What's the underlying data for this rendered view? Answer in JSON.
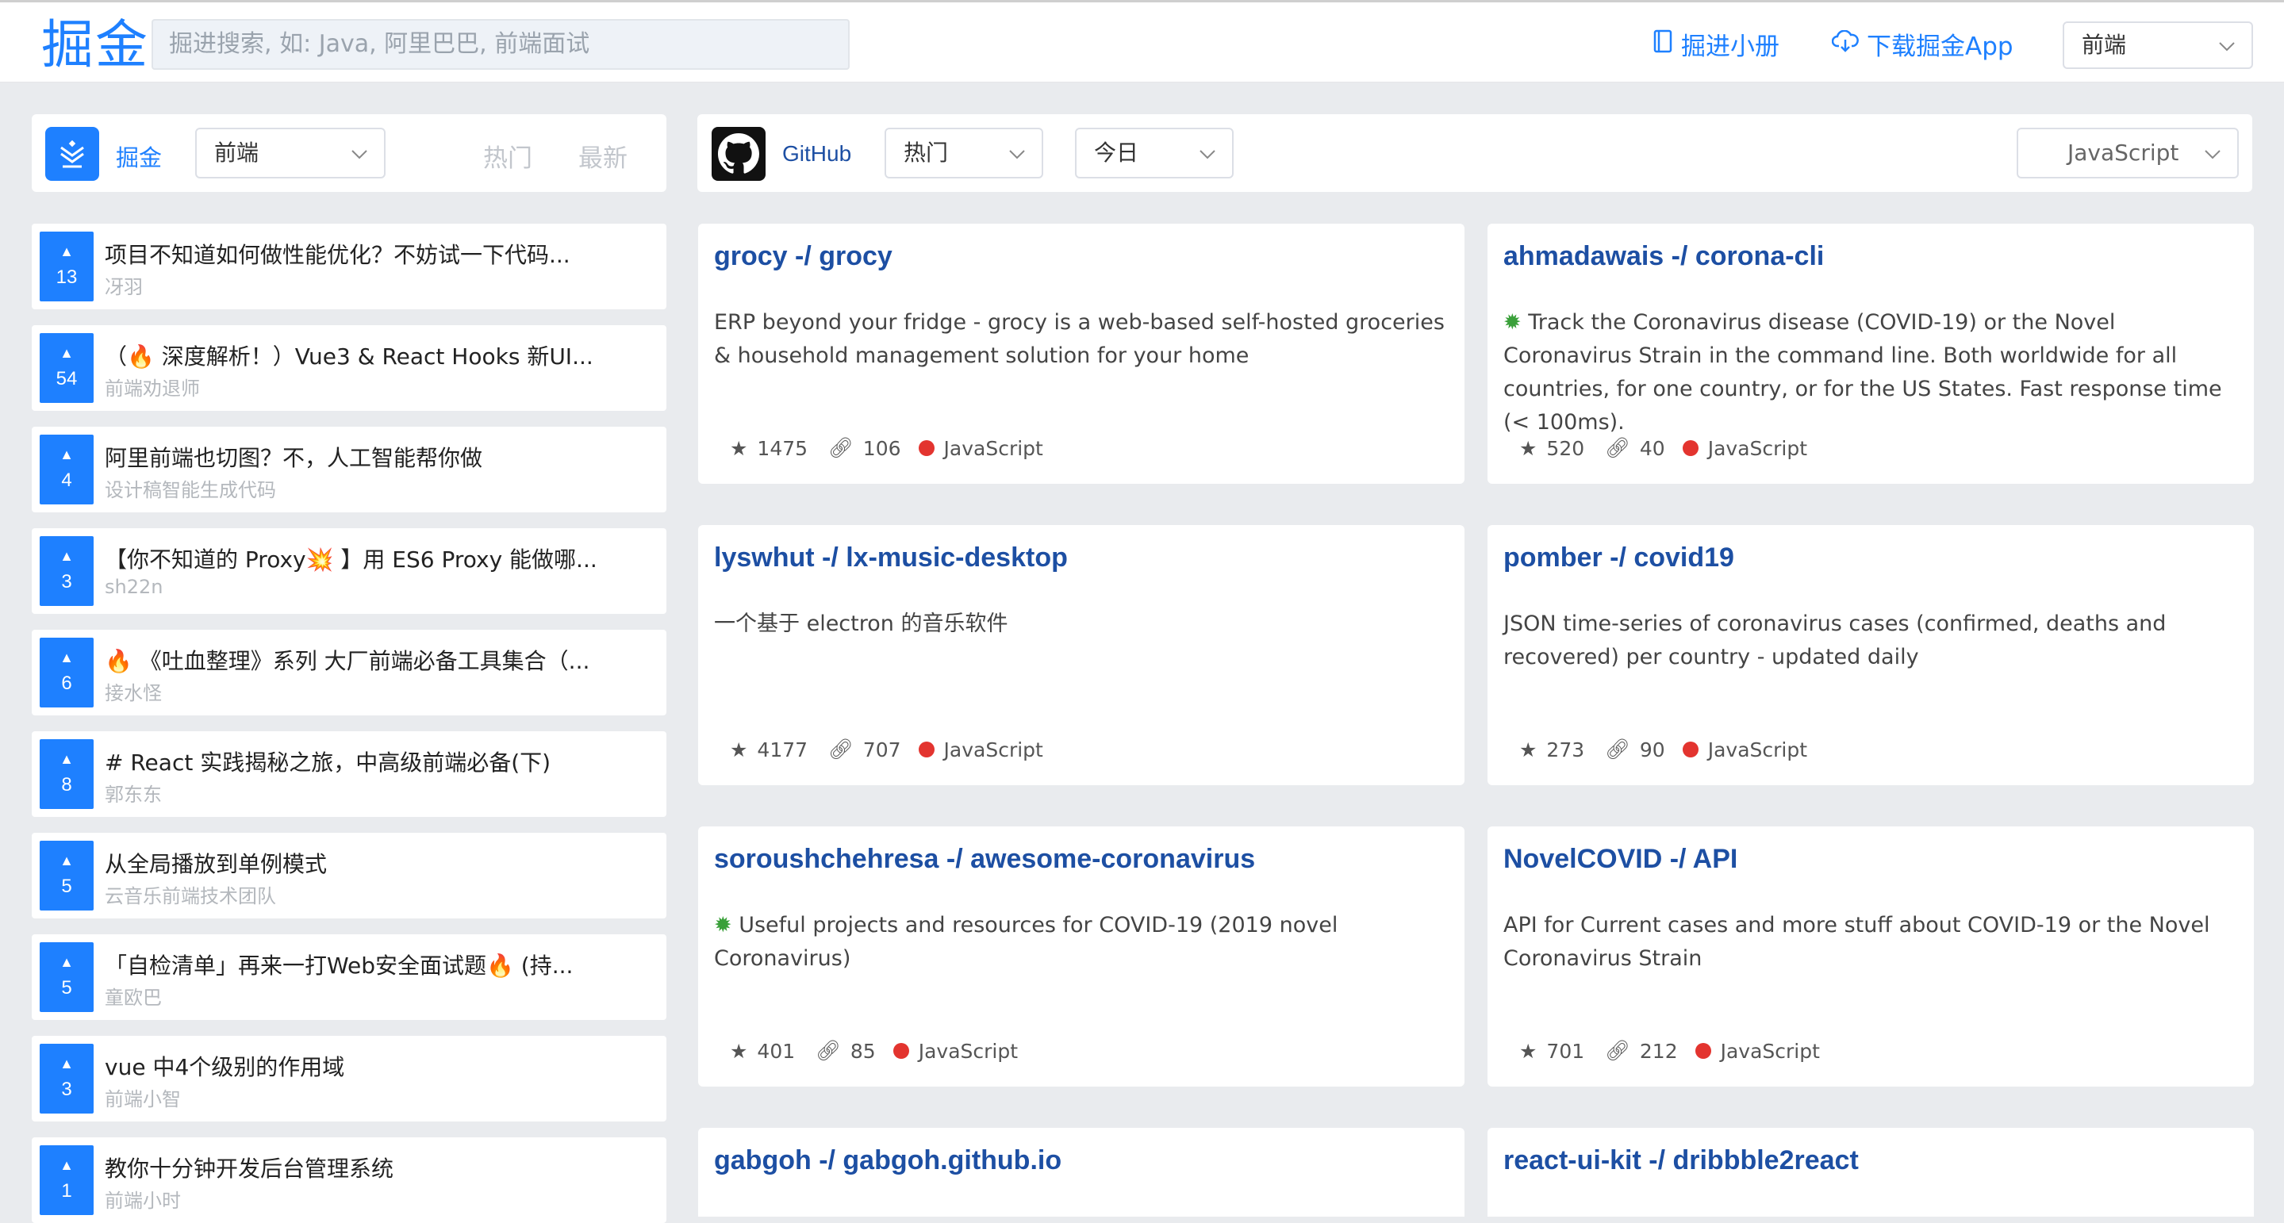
{
  "header": {
    "logo": "掘金",
    "search_placeholder": "掘进搜索, 如: Java, 阿里巴巴, 前端面试",
    "book_link": "掘进小册",
    "download_link": "下载掘金App",
    "category_select": "前端"
  },
  "left_panel": {
    "source_label": "掘金",
    "category_select": "前端",
    "tab_hot": "热门",
    "tab_new": "最新"
  },
  "right_panel": {
    "source_label": "GitHub",
    "sort_select": "热门",
    "period_select": "今日",
    "language_select": "JavaScript"
  },
  "articles": [
    {
      "votes": "13",
      "title": "项目不知道如何做性能优化？不妨试一下代码...",
      "author": "冴羽"
    },
    {
      "votes": "54",
      "title": "（🔥 深度解析！）Vue3 & React Hooks 新UI...",
      "author": "前端劝退师"
    },
    {
      "votes": "4",
      "title": "阿里前端也切图？不，人工智能帮你做",
      "author": "设计稿智能生成代码"
    },
    {
      "votes": "3",
      "title": "【你不知道的 Proxy💥 】用 ES6 Proxy 能做哪...",
      "author": "sh22n"
    },
    {
      "votes": "6",
      "title": "🔥 《吐血整理》系列 大厂前端必备工具集合（...",
      "author": "接水怪"
    },
    {
      "votes": "8",
      "title": "# React 实践揭秘之旅，中高级前端必备(下)",
      "author": "郭东东"
    },
    {
      "votes": "5",
      "title": "从全局播放到单例模式",
      "author": "云音乐前端技术团队"
    },
    {
      "votes": "5",
      "title": "「自检清单」再来一打Web安全面试题🔥 (持...",
      "author": "童欧巴"
    },
    {
      "votes": "3",
      "title": "vue 中4个级别的作用域",
      "author": "前端小智"
    },
    {
      "votes": "1",
      "title": "教你十分钟开发后台管理系统",
      "author": "前端小时"
    }
  ],
  "repos": [
    {
      "title": "grocy -/ grocy",
      "desc": "ERP beyond your fridge - grocy is a web-based self-hosted groceries & household management solution for your home",
      "virus": false,
      "stars": "1475",
      "forks": "106",
      "lang": "JavaScript"
    },
    {
      "title": "ahmadawais -/ corona-cli",
      "desc": "Track the Coronavirus disease (COVID-19) or the Novel Coronavirus Strain in the command line. Both worldwide for all countries, for one country, or for the US States. Fast response time (< 100ms).",
      "virus": true,
      "stars": "520",
      "forks": "40",
      "lang": "JavaScript"
    },
    {
      "title": "lyswhut -/ lx-music-desktop",
      "desc": "一个基于 electron 的音乐软件",
      "virus": false,
      "stars": "4177",
      "forks": "707",
      "lang": "JavaScript"
    },
    {
      "title": "pomber -/ covid19",
      "desc": "JSON time-series of coronavirus cases (confirmed, deaths and recovered) per country - updated daily",
      "virus": false,
      "stars": "273",
      "forks": "90",
      "lang": "JavaScript"
    },
    {
      "title": "soroushchehresa -/ awesome-coronavirus",
      "desc": "Useful projects and resources for COVID-19 (2019 novel Coronavirus)",
      "virus": true,
      "stars": "401",
      "forks": "85",
      "lang": "JavaScript"
    },
    {
      "title": "NovelCOVID -/ API",
      "desc": "API for Current cases and more stuff about COVID-19 or the Novel Coronavirus Strain",
      "virus": false,
      "stars": "701",
      "forks": "212",
      "lang": "JavaScript"
    },
    {
      "title": "gabgoh -/ gabgoh.github.io",
      "desc": "",
      "virus": false,
      "stars": "",
      "forks": "",
      "lang": ""
    },
    {
      "title": "react-ui-kit -/ dribbble2react",
      "desc": "",
      "virus": false,
      "stars": "",
      "forks": "",
      "lang": ""
    }
  ],
  "colors": {
    "accent": "#1e80ff",
    "repo_title": "#1d4fa3",
    "lang_dot": "#e3342f",
    "background": "#e9ebee"
  },
  "icons": {
    "book": "book-icon",
    "cloud_download": "cloud-download-icon",
    "chevron": "chevron-down-icon",
    "star": "star-icon",
    "fork": "link-icon",
    "github": "github-icon",
    "juejin": "juejin-logo-icon",
    "virus": "virus-icon"
  }
}
